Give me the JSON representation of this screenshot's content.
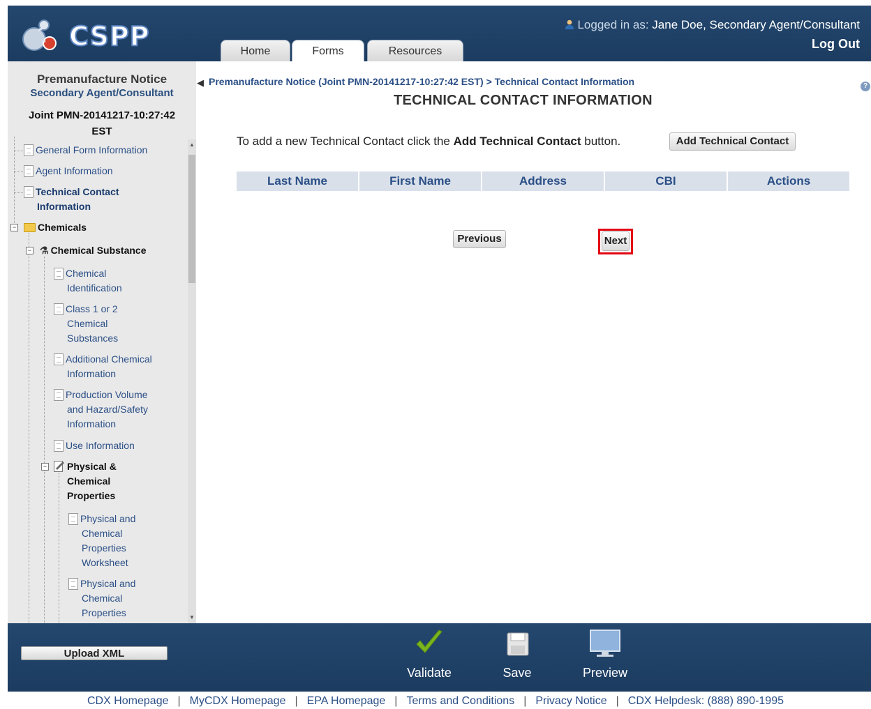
{
  "header": {
    "logo_text": "CSPP",
    "logged_in_label": "Logged in as:",
    "user": "Jane Doe, Secondary Agent/Consultant",
    "logout": "Log Out",
    "tabs": [
      {
        "label": "Home",
        "active": false
      },
      {
        "label": "Forms",
        "active": true
      },
      {
        "label": "Resources",
        "active": false
      }
    ]
  },
  "sidebar": {
    "title": "Premanufacture Notice",
    "subtitle": "Secondary Agent/Consultant",
    "submission_id_line1": "Joint PMN-20141217-10:27:42",
    "submission_id_line2": "EST",
    "items": {
      "general_form": "General Form Information",
      "agent_info": "Agent Information",
      "technical_contact_1": "Technical Contact",
      "technical_contact_2": "Information",
      "chemicals": "Chemicals",
      "chemical_substance": "Chemical Substance",
      "chem_id_1": "Chemical",
      "chem_id_2": "Identification",
      "class_1": "Class 1 or 2",
      "class_2": "Chemical",
      "class_3": "Substances",
      "additional_1": "Additional Chemical",
      "additional_2": "Information",
      "production_1": "Production Volume",
      "production_2": "and Hazard/Safety",
      "production_3": "Information",
      "use_info": "Use Information",
      "pcp_1": "Physical &",
      "pcp_2": "Chemical",
      "pcp_3": "Properties",
      "pcp_ws_1": "Physical and",
      "pcp_ws_2": "Chemical",
      "pcp_ws_3": "Properties",
      "pcp_ws_4": "Worksheet",
      "pcp_b_1": "Physical and",
      "pcp_b_2": "Chemical",
      "pcp_b_3": "Properties"
    }
  },
  "main": {
    "breadcrumb": "Premanufacture Notice (Joint PMN-20141217-10:27:42 EST) > Technical Contact Information",
    "page_title": "TECHNICAL CONTACT INFORMATION",
    "instruction_prefix": "To add a new Technical Contact click the ",
    "instruction_bold": "Add Technical Contact",
    "instruction_suffix": " button.",
    "add_button": "Add Technical Contact",
    "table_columns": [
      "Last Name",
      "First Name",
      "Address",
      "CBI",
      "Actions"
    ],
    "previous_button": "Previous",
    "next_button": "Next"
  },
  "bottombar": {
    "upload_button": "Upload XML",
    "validate": "Validate",
    "save": "Save",
    "preview": "Preview"
  },
  "footer": {
    "links": [
      "CDX Homepage",
      "MyCDX Homepage",
      "EPA Homepage",
      "Terms and Conditions",
      "Privacy Notice",
      "CDX Helpdesk: (888) 890-1995"
    ]
  },
  "colors": {
    "header_bg": "#1f4166",
    "sidebar_bg": "#e9e9e9",
    "link_blue": "#2b4f86",
    "table_header_bg": "#d9e0ea",
    "highlight_red": "#e30613",
    "validate_check": "#7ab51d"
  }
}
